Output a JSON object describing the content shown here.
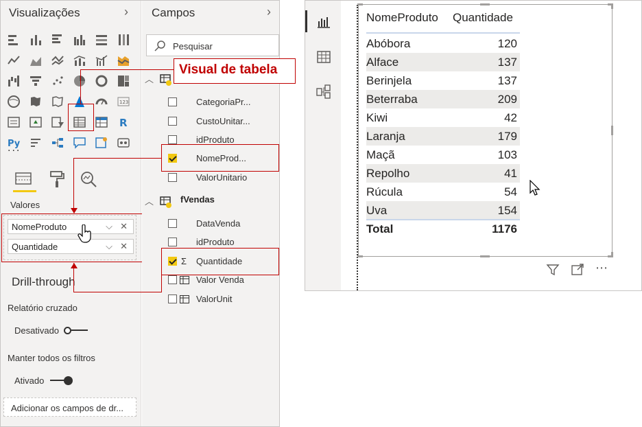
{
  "visualizations_pane": {
    "title": "Visualizações",
    "more_dots": "...",
    "wells_label": "Valores",
    "wells": [
      "NomeProduto",
      "Quantidade"
    ],
    "drillthrough_title": "Drill-through",
    "cross_report_label": "Relatório cruzado",
    "cross_report_state": "Desativado",
    "keep_filters_label": "Manter todos os filtros",
    "keep_filters_state": "Ativado",
    "add_fields_text": "Adicionar os campos de dr..."
  },
  "fields_pane": {
    "title": "Campos",
    "search_placeholder": "Pesquisar",
    "tables": [
      {
        "name": "",
        "fields": [
          {
            "label": "CategoriaPr...",
            "checked": false
          },
          {
            "label": "CustoUnitar...",
            "checked": false
          },
          {
            "label": "idProduto",
            "checked": false
          },
          {
            "label": "NomeProd...",
            "checked": true
          },
          {
            "label": "ValorUnitario",
            "checked": false
          }
        ]
      },
      {
        "name": "fVendas",
        "fields": [
          {
            "label": "DataVenda",
            "checked": false
          },
          {
            "label": "idProduto",
            "checked": false
          },
          {
            "label": "Quantidade",
            "checked": true,
            "sigma": "Σ"
          },
          {
            "label": "Valor Venda",
            "checked": false
          },
          {
            "label": "ValorUnit",
            "checked": false
          }
        ]
      }
    ]
  },
  "callout": {
    "text": "Visual de tabela",
    "color": "#c00000"
  },
  "table_visual": {
    "headers": [
      "NomeProduto",
      "Quantidade"
    ],
    "rows": [
      {
        "name": "Abóbora",
        "qty": "120"
      },
      {
        "name": "Alface",
        "qty": "137"
      },
      {
        "name": "Berinjela",
        "qty": "137"
      },
      {
        "name": "Beterraba",
        "qty": "209"
      },
      {
        "name": "Kiwi",
        "qty": "42"
      },
      {
        "name": "Laranja",
        "qty": "179"
      },
      {
        "name": "Maçã",
        "qty": "103"
      },
      {
        "name": "Repolho",
        "qty": "41"
      },
      {
        "name": "Rúcula",
        "qty": "54"
      },
      {
        "name": "Uva",
        "qty": "154"
      }
    ],
    "total_label": "Total",
    "total_value": "1176"
  },
  "colors": {
    "accent_yellow": "#f2c811",
    "annotation_red": "#c00000",
    "row_band": "#ecebe9"
  }
}
